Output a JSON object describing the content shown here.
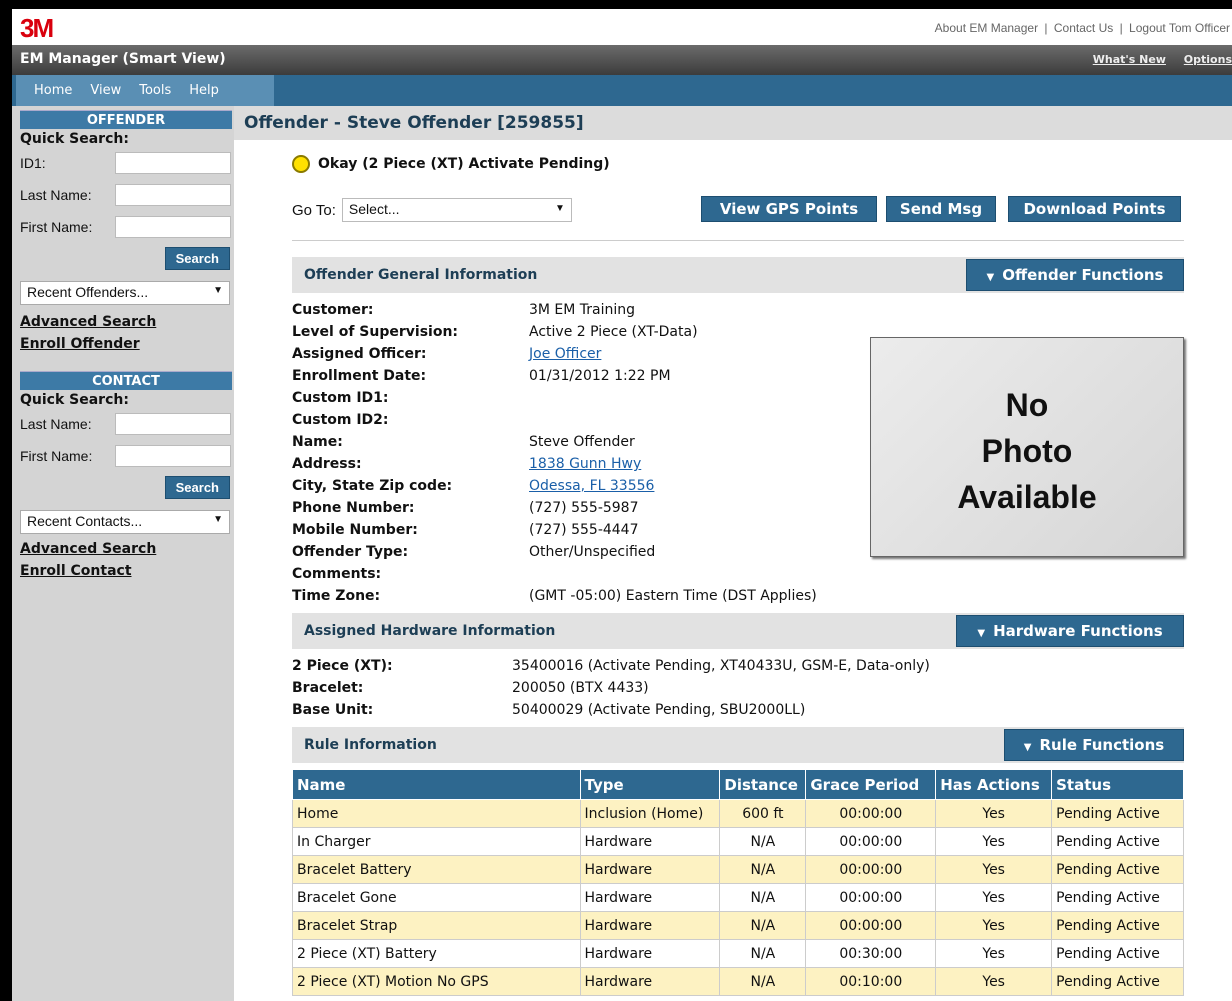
{
  "header": {
    "logo": "3M",
    "links": [
      "About EM Manager",
      "Contact Us",
      "Logout Tom Officer"
    ],
    "sep": "|"
  },
  "titlebar": {
    "title": "EM Manager (Smart View)",
    "whats_new": "What's New",
    "options": "Options"
  },
  "menu": [
    "Home",
    "View",
    "Tools",
    "Help"
  ],
  "sidebar": {
    "offender": {
      "heading": "OFFENDER",
      "quick_search": "Quick Search:",
      "id1_label": "ID1:",
      "last_label": "Last Name:",
      "first_label": "First Name:",
      "search_label": "Search",
      "recent": "Recent Offenders...",
      "advanced": "Advanced Search",
      "enroll": "Enroll Offender"
    },
    "contact": {
      "heading": "CONTACT",
      "quick_search": "Quick Search:",
      "last_label": "Last Name:",
      "first_label": "First Name:",
      "search_label": "Search",
      "recent": "Recent Contacts...",
      "advanced": "Advanced Search",
      "enroll": "Enroll Contact"
    }
  },
  "main": {
    "title": "Offender - Steve Offender [259855]",
    "status": "Okay (2 Piece (XT) Activate Pending)",
    "status_color": "#ffe100",
    "goto_label": "Go To:",
    "goto_value": "Select...",
    "buttons": {
      "gps": "View GPS Points",
      "msg": "Send Msg",
      "download": "Download Points"
    },
    "general": {
      "heading": "Offender General Information",
      "functions": "Offender Functions",
      "rows": [
        {
          "k": "Customer:",
          "v": "3M EM Training"
        },
        {
          "k": "Level of Supervision:",
          "v": "Active 2 Piece (XT-Data)"
        },
        {
          "k": "Assigned Officer:",
          "v": "Joe Officer"
        },
        {
          "k": "Enrollment Date:",
          "v": "01/31/2012 1:22 PM"
        },
        {
          "k": "Custom ID1:",
          "v": ""
        },
        {
          "k": "Custom ID2:",
          "v": ""
        },
        {
          "k": "Name:",
          "v": "Steve Offender"
        },
        {
          "k": "Address:",
          "v": "1838 Gunn Hwy"
        },
        {
          "k": "City, State Zip code:",
          "v": "Odessa, FL 33556"
        },
        {
          "k": "Phone Number:",
          "v": "(727) 555-5987"
        },
        {
          "k": "Mobile Number:",
          "v": "(727) 555-4447"
        },
        {
          "k": "Offender Type:",
          "v": "Other/Unspecified"
        },
        {
          "k": "Comments:",
          "v": ""
        },
        {
          "k": "Time Zone:",
          "v": "(GMT -05:00) Eastern Time (DST Applies)"
        }
      ],
      "photo_line1": "No",
      "photo_line2": "Photo",
      "photo_line3": "Available"
    },
    "hardware": {
      "heading": "Assigned Hardware Information",
      "functions": "Hardware Functions",
      "rows": [
        {
          "k": "2 Piece (XT):",
          "v": "35400016 (Activate Pending, XT40433U, GSM-E, Data-only)"
        },
        {
          "k": "Bracelet:",
          "v": "200050 (BTX 4433)"
        },
        {
          "k": "Base Unit:",
          "v": "50400029 (Activate Pending, SBU2000LL)"
        }
      ]
    },
    "rules": {
      "heading": "Rule Information",
      "functions": "Rule Functions",
      "columns": [
        "Name",
        "Type",
        "Distance",
        "Grace Period",
        "Has Actions",
        "Status"
      ],
      "rows": [
        [
          "Home",
          "Inclusion (Home)",
          "600 ft",
          "00:00:00",
          "Yes",
          "Pending Active"
        ],
        [
          "In Charger",
          "Hardware",
          "N/A",
          "00:00:00",
          "Yes",
          "Pending Active"
        ],
        [
          "Bracelet Battery",
          "Hardware",
          "N/A",
          "00:00:00",
          "Yes",
          "Pending Active"
        ],
        [
          "Bracelet Gone",
          "Hardware",
          "N/A",
          "00:00:00",
          "Yes",
          "Pending Active"
        ],
        [
          "Bracelet Strap",
          "Hardware",
          "N/A",
          "00:00:00",
          "Yes",
          "Pending Active"
        ],
        [
          "2 Piece (XT) Battery",
          "Hardware",
          "N/A",
          "00:30:00",
          "Yes",
          "Pending Active"
        ],
        [
          "2 Piece (XT) Motion No GPS",
          "Hardware",
          "N/A",
          "00:10:00",
          "Yes",
          "Pending Active"
        ]
      ]
    }
  }
}
